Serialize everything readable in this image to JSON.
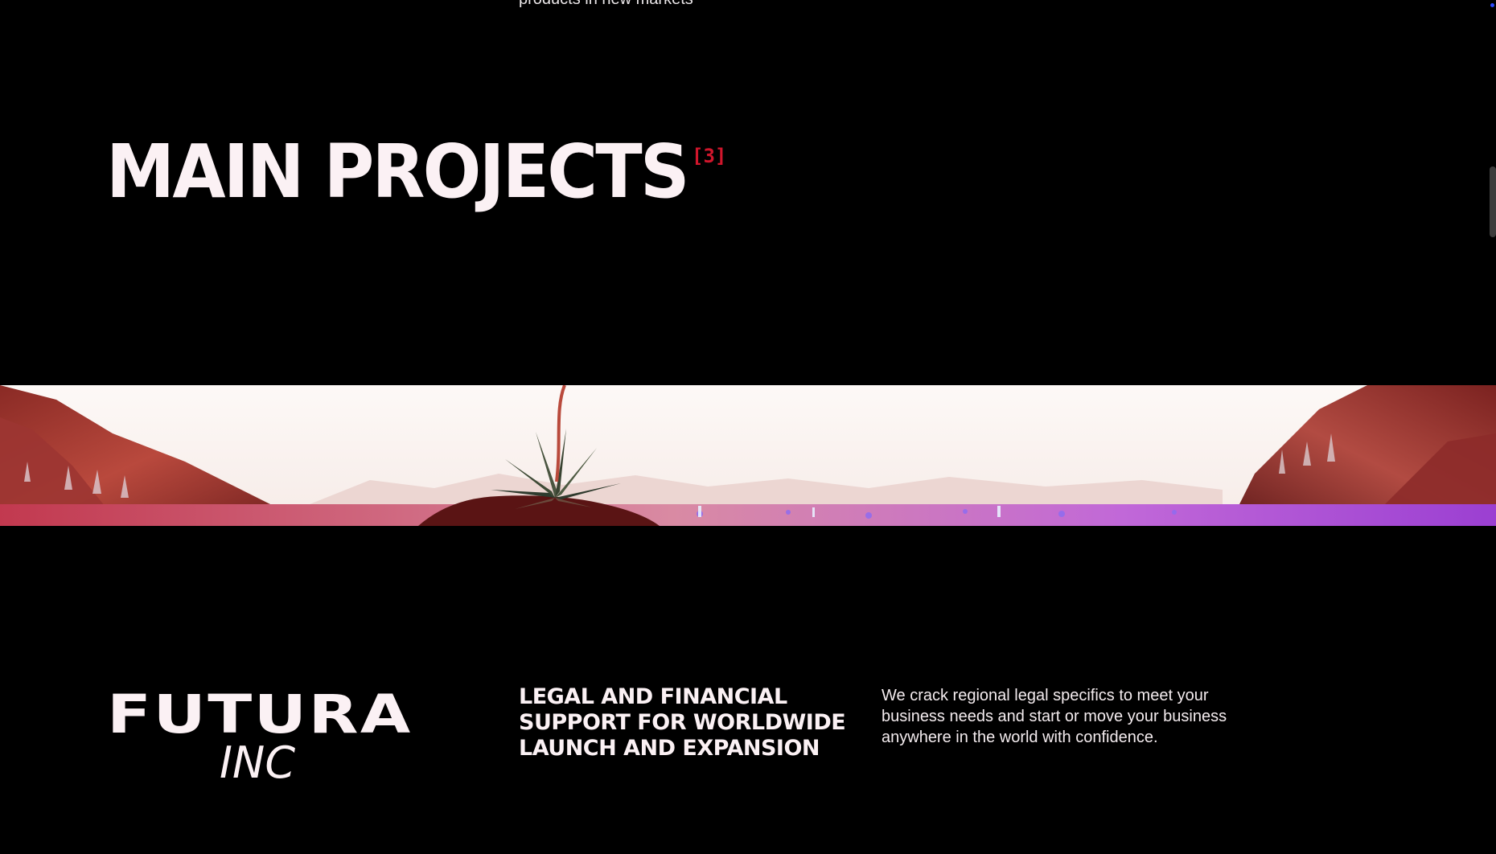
{
  "previous_section": {
    "cut_text": "products in new markets"
  },
  "projects": {
    "heading": "MAIN PROJECTS",
    "count_label": "[3]"
  },
  "banner": {
    "image_name": "alien-landscape-flower-banner"
  },
  "project": {
    "logo_main": "FUTURA",
    "logo_sub": "INC",
    "title": "LEGAL AND FINANCIAL SUPPORT FOR WORLDWIDE LAUNCH AND EXPANSION",
    "description": "We crack regional legal specifics to meet your business needs and start or move your business anywhere in the world with confidence."
  },
  "colors": {
    "background": "#000000",
    "text": "#fbf1f4",
    "accent": "#d1162c"
  }
}
